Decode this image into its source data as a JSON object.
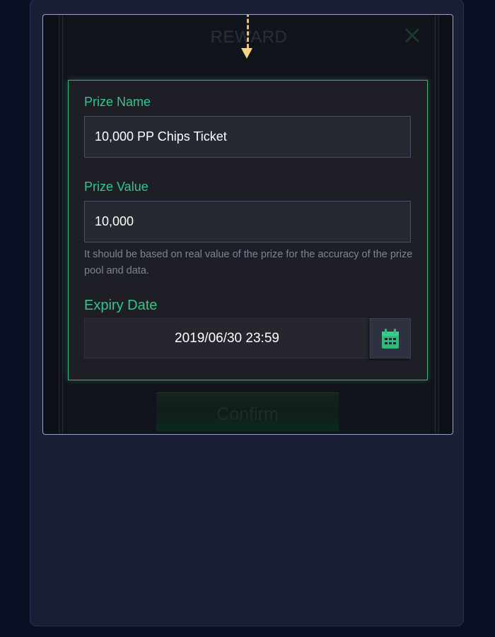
{
  "modal": {
    "title": "REWARD",
    "confirm_label": "Confirm"
  },
  "form": {
    "prize_name_label": "Prize Name",
    "prize_name_value": "10,000 PP Chips Ticket",
    "prize_value_label": "Prize Value",
    "prize_value_value": "10,000",
    "hint": "It should be based on real value of the prize for the accuracy of the prize pool and data.",
    "expiry_label": "Expiry Date",
    "expiry_value": "2019/06/30 23:59"
  },
  "icons": {
    "close": "close-icon",
    "calendar": "calendar-icon",
    "arrow": "arrow-down-dashed"
  },
  "colors": {
    "accent": "#35c48d",
    "arrow": "#f0c061",
    "background": "#0a0f24",
    "panel": "#1b1f35"
  }
}
